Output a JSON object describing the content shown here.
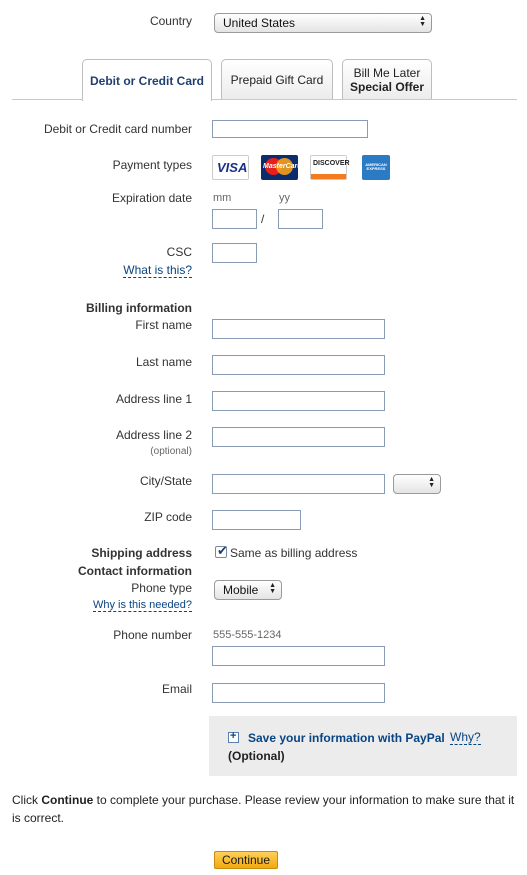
{
  "country": {
    "label": "Country",
    "value": "United States"
  },
  "tabs": [
    {
      "label": "Debit or Credit Card"
    },
    {
      "label": "Prepaid Gift Card"
    },
    {
      "label_line1": "Bill Me Later",
      "label_line2": "Special Offer"
    }
  ],
  "card": {
    "number_label": "Debit or Credit card number",
    "payment_types_label": "Payment types",
    "logos": [
      "VISA",
      "MasterCard",
      "DISCOVER",
      "AMERICAN EXPRESS"
    ],
    "expiration_label": "Expiration date",
    "mm_hint": "mm",
    "yy_hint": "yy",
    "separator": "/",
    "csc_label": "CSC",
    "csc_link": "What is this?"
  },
  "billing": {
    "heading": "Billing information",
    "first_name": "First name",
    "last_name": "Last name",
    "address1": "Address line 1",
    "address2": "Address line 2",
    "optional_hint": "(optional)",
    "city_state": "City/State",
    "zip": "ZIP code"
  },
  "shipping": {
    "heading": "Shipping address",
    "same_label": "Same as billing address",
    "same_checked": true
  },
  "contact": {
    "heading": "Contact information",
    "phone_type_label": "Phone type",
    "phone_type_value": "Mobile",
    "why_link": "Why is this needed?",
    "phone_number_label": "Phone number",
    "phone_hint": "555-555-1234",
    "email_label": "Email"
  },
  "save_box": {
    "text": "Save your information with PayPal",
    "why_link": "Why?",
    "optional": "(Optional)"
  },
  "footer": {
    "prefix": "Click ",
    "bold": "Continue",
    "rest": " to complete your purchase. Please review your information to make sure that it is correct."
  },
  "continue_button": "Continue",
  "colors": {
    "link": "#084482",
    "button": "#f6b21f",
    "panel": "#ececec"
  }
}
